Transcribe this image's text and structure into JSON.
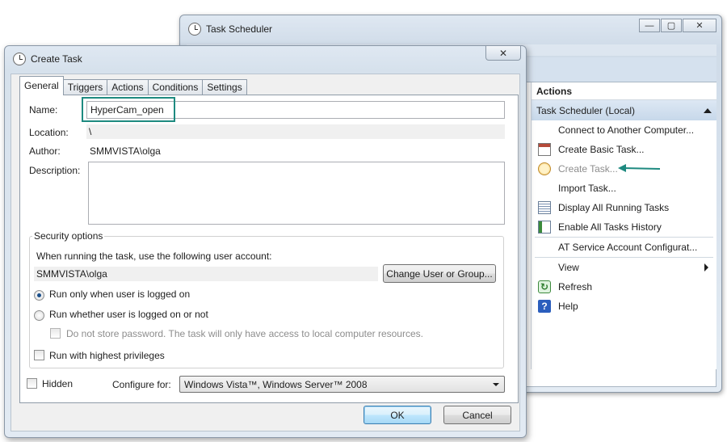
{
  "background_window": {
    "title": "Task Scheduler",
    "window_buttons": [
      "—",
      "▢",
      "✕"
    ],
    "actions_pane": {
      "header": "Actions",
      "section": "Task Scheduler (Local)",
      "items": [
        {
          "label": "Connect to Another Computer...",
          "icon": "none"
        },
        {
          "label": "Create Basic Task...",
          "icon": "calendar-icon"
        },
        {
          "label": "Create Task...",
          "icon": "clock-icon"
        },
        {
          "label": "Import Task...",
          "icon": "none"
        },
        {
          "label": "Display All Running Tasks",
          "icon": "list-icon"
        },
        {
          "label": "Enable All Tasks History",
          "icon": "history-icon"
        },
        {
          "label": "AT Service Account Configurat...",
          "icon": "none"
        },
        {
          "label": "View",
          "icon": "none"
        },
        {
          "label": "Refresh",
          "icon": "refresh-icon"
        },
        {
          "label": "Help",
          "icon": "help-icon"
        }
      ]
    },
    "annotation_arrow_color": "#1e8a80"
  },
  "dialog": {
    "title": "Create Task",
    "close_glyph": "✕",
    "tabs": [
      "General",
      "Triggers",
      "Actions",
      "Conditions",
      "Settings"
    ],
    "active_tab": "General",
    "general": {
      "name_label": "Name:",
      "name_value": "HyperCam_open",
      "location_label": "Location:",
      "location_value": "\\",
      "author_label": "Author:",
      "author_value": "SMMVISTA\\olga",
      "description_label": "Description:",
      "description_value": ""
    },
    "security": {
      "title": "Security options",
      "account_prompt": "When running the task, use the following user account:",
      "account_value": "SMMVISTA\\olga",
      "change_button": "Change User or Group...",
      "radio_logged_on": "Run only when user is logged on",
      "radio_whether": "Run whether user is logged on or not",
      "no_store_password": "Do not store password.  The task will only have access to local computer resources.",
      "highest_privileges": "Run with highest privileges",
      "selected_radio": "Run only when user is logged on"
    },
    "hidden_label": "Hidden",
    "configure_label": "Configure for:",
    "configure_value": "Windows Vista™, Windows Server™ 2008",
    "ok_button": "OK",
    "cancel_button": "Cancel",
    "highlight_color": "#1e8a80"
  }
}
